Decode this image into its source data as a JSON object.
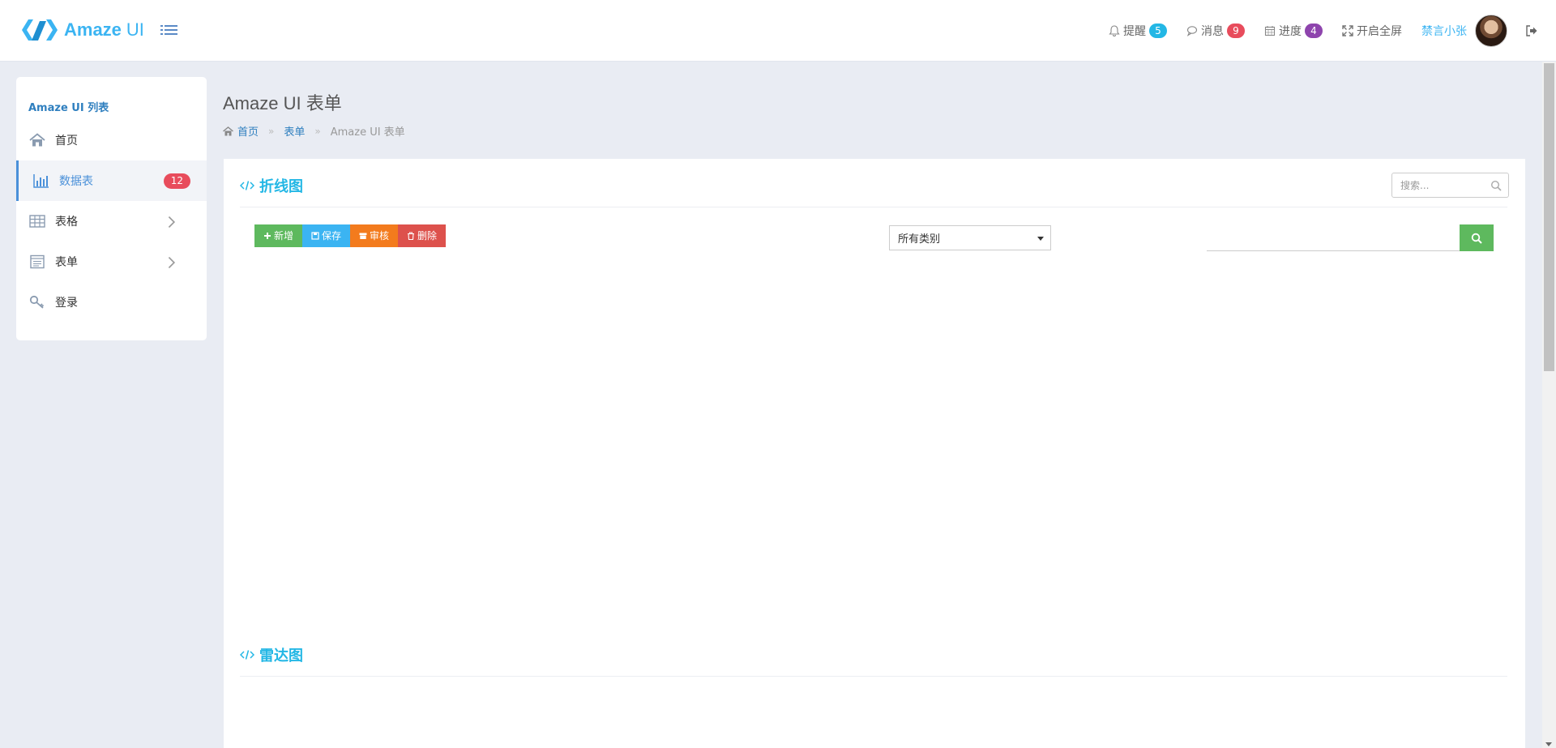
{
  "header": {
    "logo_text": "Amaze",
    "logo_text_thin": "UI",
    "nav": [
      {
        "label": "提醒",
        "count": "5",
        "color": "#23b7e5",
        "icon": "bell-icon"
      },
      {
        "label": "消息",
        "count": "9",
        "color": "#e84c5c",
        "icon": "comment-icon"
      },
      {
        "label": "进度",
        "count": "4",
        "color": "#8e44ad",
        "icon": "calendar-icon"
      },
      {
        "label": "开启全屏",
        "icon": "fullscreen-icon"
      }
    ],
    "user_name": "禁言小张"
  },
  "sidebar": {
    "title": "Amaze UI 列表",
    "items": [
      {
        "label": "首页",
        "icon": "home-icon"
      },
      {
        "label": "数据表",
        "icon": "bar-chart-icon",
        "badge": "12",
        "active": true
      },
      {
        "label": "表格",
        "icon": "table-icon",
        "submenu": true
      },
      {
        "label": "表单",
        "icon": "form-icon",
        "submenu": true
      },
      {
        "label": "登录",
        "icon": "key-icon"
      }
    ]
  },
  "page": {
    "title": "Amaze UI 表单",
    "breadcrumb": [
      "首页",
      "表单",
      "Amaze UI 表单"
    ]
  },
  "card": {
    "section1_title": "折线图",
    "section2_title": "雷达图",
    "search_placeholder": "搜索...",
    "buttons": [
      {
        "label": "新增",
        "icon": "plus-icon",
        "color": "#5eb95e"
      },
      {
        "label": "保存",
        "icon": "save-icon",
        "color": "#3bb4f2"
      },
      {
        "label": "审核",
        "icon": "archive-icon",
        "color": "#f37b1d"
      },
      {
        "label": "删除",
        "icon": "trash-icon",
        "color": "#dd514c"
      }
    ],
    "category_select": "所有类别"
  }
}
